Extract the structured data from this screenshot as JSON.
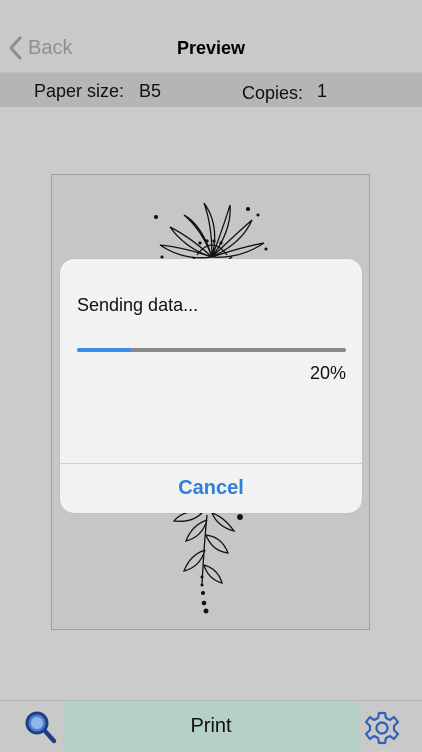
{
  "nav": {
    "back_label": "Back",
    "title": "Preview"
  },
  "settings": {
    "paper_size_label": "Paper size:",
    "paper_size_value": "B5",
    "copies_label": "Copies:",
    "copies_value": "1"
  },
  "dialog": {
    "message": "Sending data...",
    "progress": 0.2,
    "progress_text": "20%",
    "cancel_label": "Cancel"
  },
  "toolbar": {
    "search_icon": "magnifier-icon",
    "print_label": "Print",
    "settings_icon": "gear-icon"
  },
  "colors": {
    "accent": "#2f7fd8",
    "progress": "#3a8ee6",
    "print_button": "#b5d0c6"
  }
}
